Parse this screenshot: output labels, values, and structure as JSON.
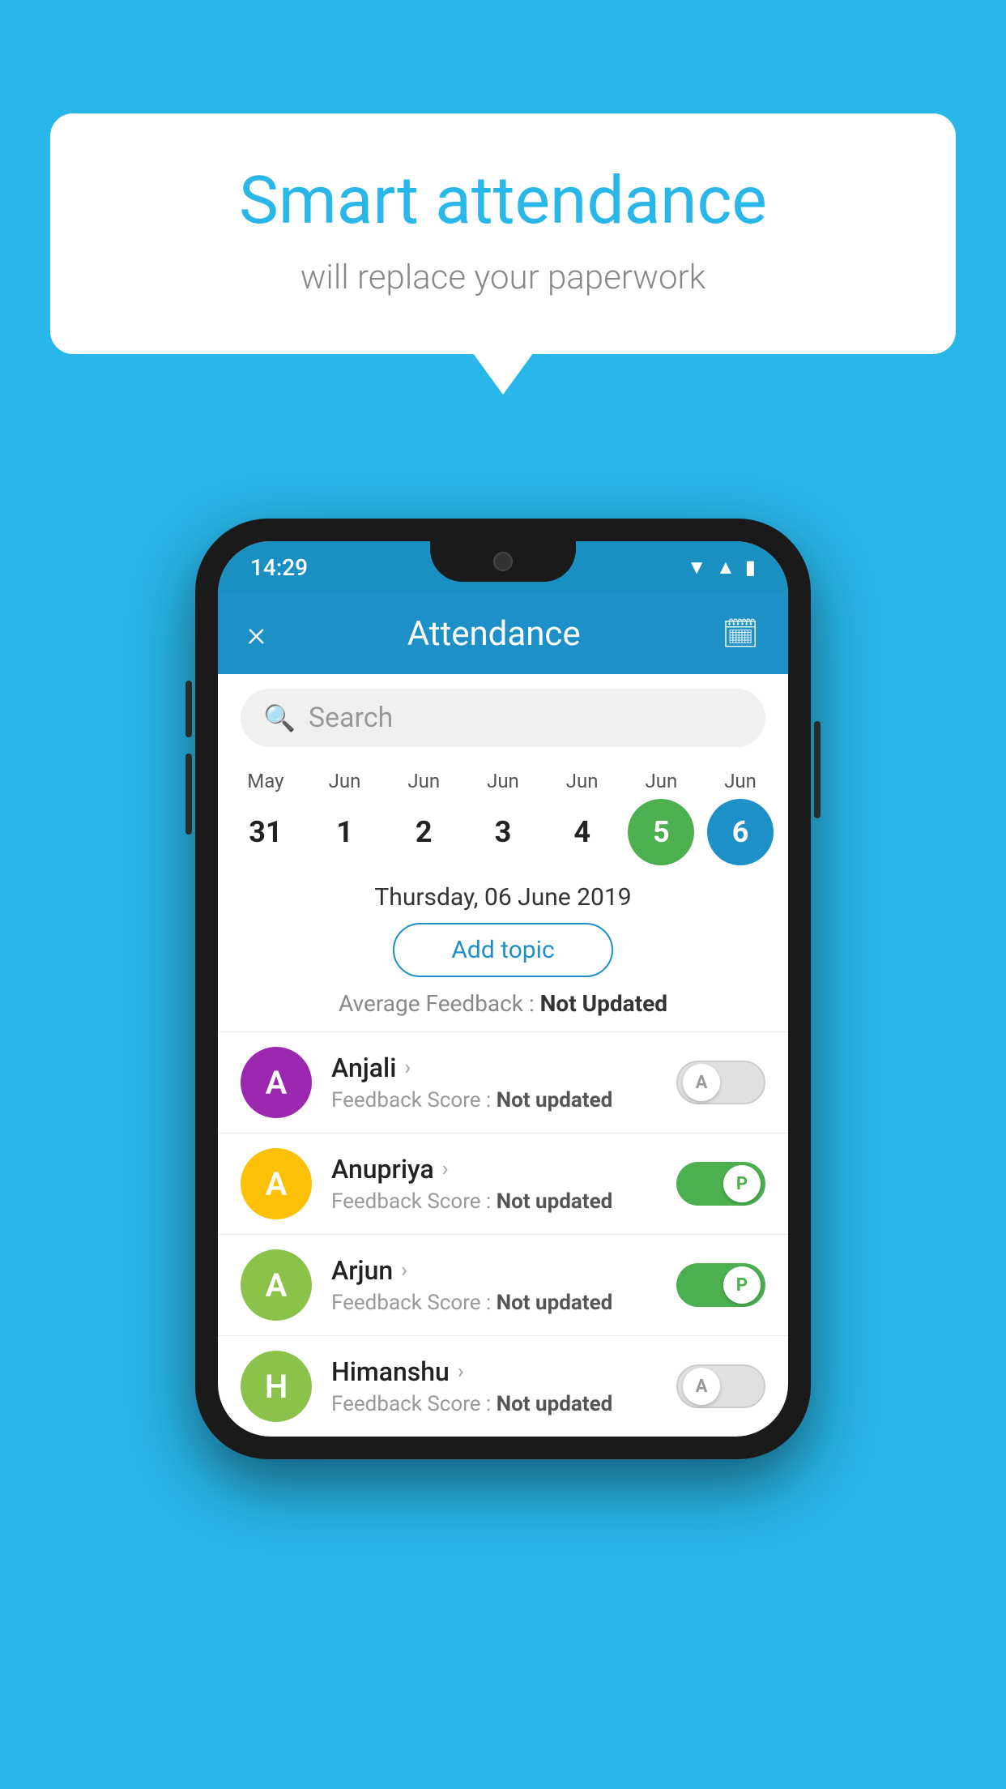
{
  "background_color": "#29b6e8",
  "bubble": {
    "title": "Smart attendance",
    "subtitle": "will replace your paperwork"
  },
  "status_bar": {
    "time": "14:29"
  },
  "app_bar": {
    "title": "Attendance",
    "close_label": "×",
    "calendar_icon": "📅"
  },
  "search": {
    "placeholder": "Search"
  },
  "calendar": {
    "days": [
      {
        "month": "May",
        "date": "31",
        "style": "normal"
      },
      {
        "month": "Jun",
        "date": "1",
        "style": "normal"
      },
      {
        "month": "Jun",
        "date": "2",
        "style": "normal"
      },
      {
        "month": "Jun",
        "date": "3",
        "style": "normal"
      },
      {
        "month": "Jun",
        "date": "4",
        "style": "normal"
      },
      {
        "month": "Jun",
        "date": "5",
        "style": "green"
      },
      {
        "month": "Jun",
        "date": "6",
        "style": "blue"
      }
    ],
    "selected_date": "Thursday, 06 June 2019"
  },
  "add_topic_label": "Add topic",
  "avg_feedback_label": "Average Feedback : ",
  "avg_feedback_value": "Not Updated",
  "students": [
    {
      "name": "Anjali",
      "avatar_letter": "A",
      "avatar_color": "#9c27b0",
      "feedback_label": "Feedback Score : ",
      "feedback_value": "Not updated",
      "attendance": "absent",
      "toggle_label": "A"
    },
    {
      "name": "Anupriya",
      "avatar_letter": "A",
      "avatar_color": "#ffc107",
      "feedback_label": "Feedback Score : ",
      "feedback_value": "Not updated",
      "attendance": "present",
      "toggle_label": "P"
    },
    {
      "name": "Arjun",
      "avatar_letter": "A",
      "avatar_color": "#8bc34a",
      "feedback_label": "Feedback Score : ",
      "feedback_value": "Not updated",
      "attendance": "present",
      "toggle_label": "P"
    },
    {
      "name": "Himanshu",
      "avatar_letter": "H",
      "avatar_color": "#8bc34a",
      "feedback_label": "Feedback Score : ",
      "feedback_value": "Not updated",
      "attendance": "absent",
      "toggle_label": "A"
    }
  ]
}
